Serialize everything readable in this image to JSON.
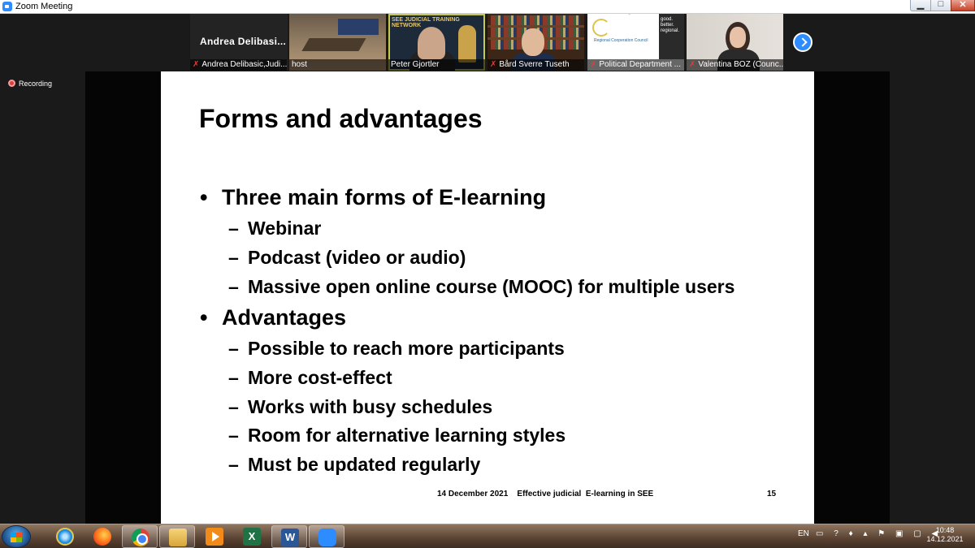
{
  "window": {
    "title": "Zoom Meeting",
    "minimize": "▁",
    "maximize": "□",
    "close": "✕"
  },
  "active_speaker": {
    "name": "Andrea  Delibasi..."
  },
  "participants": [
    {
      "label": "Andrea Delibasic,Judi..."
    },
    {
      "label": "host"
    },
    {
      "label": "Peter Gjortler",
      "banner": "SEE JUDICIAL TRAINING NETWORK"
    },
    {
      "label": "Bård Sverre Tuseth"
    },
    {
      "label": "Political Department ...",
      "logo_text": "Regional Cooperation Council",
      "slogan": "good. better. regional."
    },
    {
      "label": "Valentina BOZ (Counc..."
    }
  ],
  "recording": {
    "label": "Recording"
  },
  "slide": {
    "title": "Forms and advantages",
    "bullets": [
      {
        "text": "Three main forms of E-learning",
        "sub": [
          "Webinar",
          "Podcast (video or audio)",
          "Massive open online course (MOOC) for multiple users"
        ]
      },
      {
        "text": "Advantages",
        "sub": [
          "Possible to reach more participants",
          "More cost-effect",
          "Works with busy schedules",
          "Room for alternative learning styles",
          "Must be updated regularly"
        ]
      }
    ],
    "footer": "14 December 2021    Effective judicial  E-learning in SEE",
    "page": "15"
  },
  "taskbar": {
    "apps": [
      "internet-explorer-icon",
      "firefox-icon",
      "chrome-icon",
      "file-explorer-icon",
      "media-player-icon",
      "excel-icon",
      "word-icon",
      "zoom-icon"
    ],
    "excel_letter": "X",
    "word_letter": "W",
    "language": "EN",
    "tray_icons": "▭ ? ♦ ▴ ⚑ ▣ ▢ ◀",
    "time": "10:48",
    "date": "14.12.2021"
  },
  "colors": {
    "zoom_blue": "#2d8cff",
    "recording_red": "#e03c3c",
    "mute_red": "#e23b3b"
  }
}
